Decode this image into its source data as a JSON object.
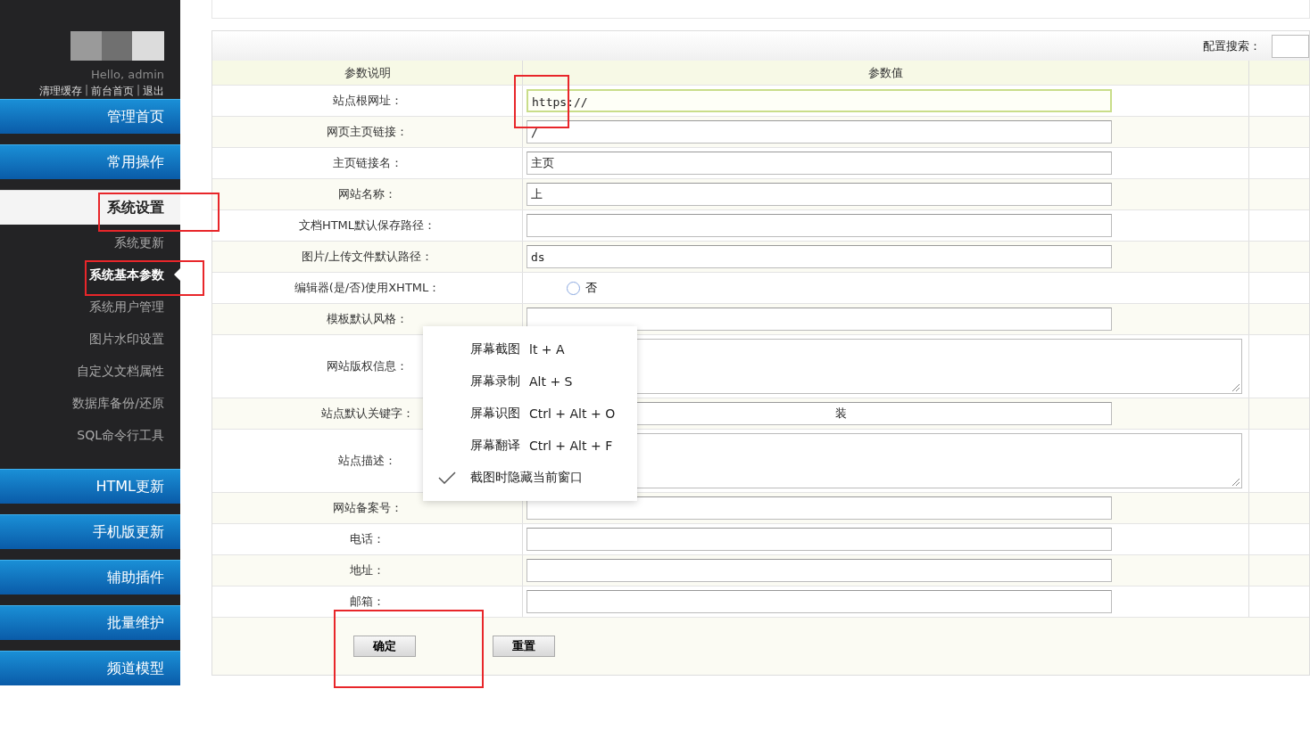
{
  "sidebar": {
    "greeting": "Hello, admin",
    "links": [
      "清理缓存",
      "前台首页",
      "退出"
    ],
    "link_separator": "|",
    "menu": [
      {
        "label": "管理首页",
        "expanded": false
      },
      {
        "label": "常用操作",
        "expanded": false
      },
      {
        "label": "系统设置",
        "expanded": true,
        "children": [
          {
            "label": "系统更新",
            "selected": false
          },
          {
            "label": "系统基本参数",
            "selected": true
          },
          {
            "label": "系统用户管理",
            "selected": false
          },
          {
            "label": "图片水印设置",
            "selected": false
          },
          {
            "label": "自定义文档属性",
            "selected": false
          },
          {
            "label": "数据库备份/还原",
            "selected": false
          },
          {
            "label": "SQL命令行工具",
            "selected": false
          }
        ]
      },
      {
        "label": "HTML更新",
        "expanded": false
      },
      {
        "label": "手机版更新",
        "expanded": false
      },
      {
        "label": "辅助插件",
        "expanded": false
      },
      {
        "label": "批量维护",
        "expanded": false
      },
      {
        "label": "频道模型",
        "expanded": false
      }
    ]
  },
  "search": {
    "label": "配置搜索："
  },
  "table": {
    "columns": [
      "参数说明",
      "参数值"
    ],
    "rows": [
      {
        "label": "站点根网址：",
        "kind": "text",
        "value": "https://",
        "focused": true
      },
      {
        "label": "网页主页链接：",
        "kind": "text",
        "value": "/",
        "focused": false
      },
      {
        "label": "主页链接名：",
        "kind": "text",
        "value": "主页",
        "focused": false
      },
      {
        "label": "网站名称：",
        "kind": "text",
        "value": "上",
        "focused": false
      },
      {
        "label": "文档HTML默认保存路径：",
        "kind": "text",
        "focused": false
      },
      {
        "label": "图片/上传文件默认路径：",
        "kind": "text",
        "value": "ds",
        "focused": false
      },
      {
        "label": "编辑器(是/否)使用XHTML：",
        "kind": "radio",
        "option": "否",
        "checked": false
      },
      {
        "label": "模板默认风格：",
        "kind": "text",
        "focused": false
      },
      {
        "label": "网站版权信息：",
        "kind": "textarea"
      },
      {
        "label": "站点默认关键字：",
        "kind": "text",
        "value": "装",
        "focused": false,
        "redacted": true
      },
      {
        "label": "站点描述：",
        "kind": "textarea"
      },
      {
        "label": "网站备案号：",
        "kind": "text",
        "focused": false
      },
      {
        "label": "电话：",
        "kind": "text",
        "focused": false
      },
      {
        "label": "地址：",
        "kind": "text",
        "focused": false
      },
      {
        "label": "邮箱：",
        "kind": "text",
        "focused": false
      }
    ]
  },
  "buttons": [
    "确定",
    "重置"
  ],
  "context_menu": [
    {
      "label": "屏幕截图",
      "shortcut": "lt + A",
      "checked": false
    },
    {
      "label": "屏幕录制",
      "shortcut": "Alt + S",
      "checked": false
    },
    {
      "label": "屏幕识图",
      "shortcut": "Ctrl + Alt + O",
      "checked": false
    },
    {
      "label": "屏幕翻译",
      "shortcut": "Ctrl + Alt + F",
      "checked": false
    },
    {
      "label": "截图时隐藏当前窗口",
      "checked": true
    }
  ]
}
